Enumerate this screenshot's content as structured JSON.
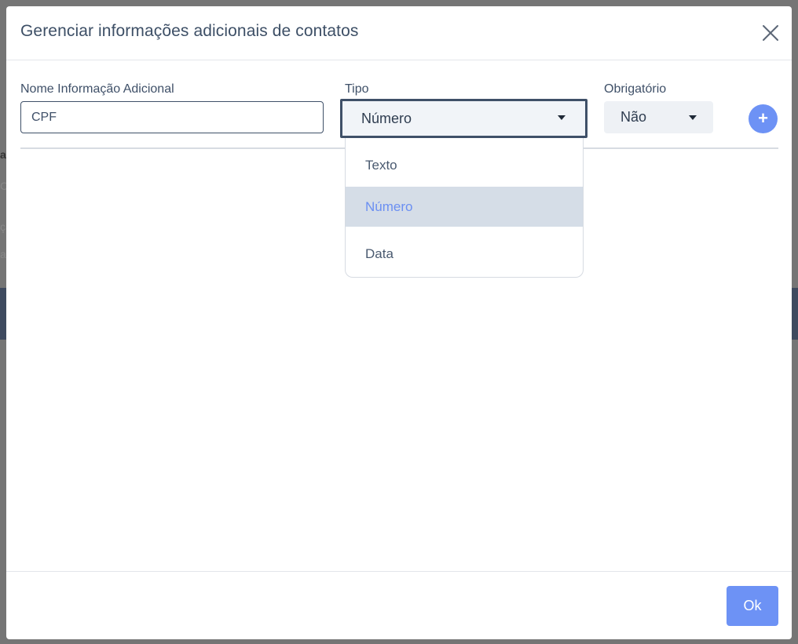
{
  "modal": {
    "title": "Gerenciar informações adicionais de contatos",
    "close_icon": "close-icon"
  },
  "form": {
    "name_label": "Nome Informação Adicional",
    "name_value": "CPF",
    "type_label": "Tipo",
    "type_value": "Número",
    "required_label": "Obrigatório",
    "required_value": "Não",
    "add_icon": "plus-icon",
    "add_symbol": "+"
  },
  "type_options": [
    {
      "label": "Texto"
    },
    {
      "label": "Número",
      "selected": true
    },
    {
      "label": "Data"
    }
  ],
  "footer": {
    "ok_label": "Ok"
  },
  "background_fragments": [
    "a",
    "Ca",
    "çã",
    "a"
  ],
  "colors": {
    "accent": "#6d92f5",
    "text": "#3f5068",
    "selected_bg": "#d5dde7"
  }
}
